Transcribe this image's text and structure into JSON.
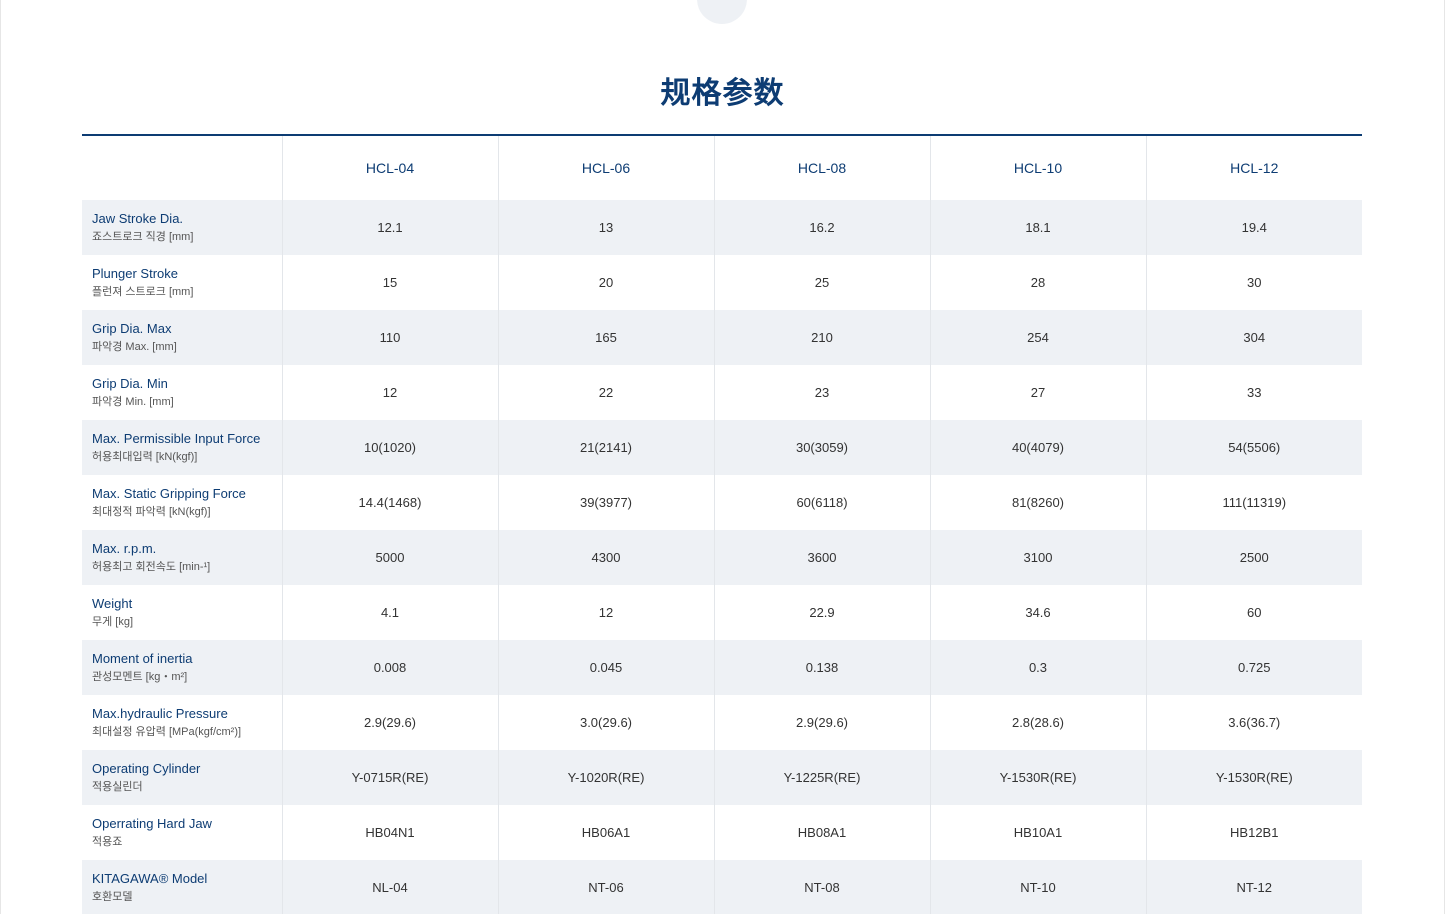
{
  "title": "规格参数",
  "columns": [
    "HCL-04",
    "HCL-06",
    "HCL-08",
    "HCL-10",
    "HCL-12"
  ],
  "rows": [
    {
      "label_en": "Jaw Stroke Dia.",
      "label_ko": "죠스트로크 직경 [mm]",
      "values": [
        "12.1",
        "13",
        "16.2",
        "18.1",
        "19.4"
      ]
    },
    {
      "label_en": "Plunger Stroke",
      "label_ko": "플런져 스트로크 [mm]",
      "values": [
        "15",
        "20",
        "25",
        "28",
        "30"
      ]
    },
    {
      "label_en": "Grip Dia. Max",
      "label_ko": "파악경 Max. [mm]",
      "values": [
        "110",
        "165",
        "210",
        "254",
        "304"
      ]
    },
    {
      "label_en": "Grip Dia. Min",
      "label_ko": "파악경 Min. [mm]",
      "values": [
        "12",
        "22",
        "23",
        "27",
        "33"
      ]
    },
    {
      "label_en": "Max. Permissible Input Force",
      "label_ko": "허용최대입력 [kN(kgf)]",
      "values": [
        "10(1020)",
        "21(2141)",
        "30(3059)",
        "40(4079)",
        "54(5506)"
      ]
    },
    {
      "label_en": "Max. Static Gripping Force",
      "label_ko": "최대정적 파악력 [kN(kgf)]",
      "values": [
        "14.4(1468)",
        "39(3977)",
        "60(6118)",
        "81(8260)",
        "111(11319)"
      ]
    },
    {
      "label_en": "Max. r.p.m.",
      "label_ko": "허용최고 회전속도 [min-¹]",
      "values": [
        "5000",
        "4300",
        "3600",
        "3100",
        "2500"
      ]
    },
    {
      "label_en": "Weight",
      "label_ko": "무게 [kg]",
      "values": [
        "4.1",
        "12",
        "22.9",
        "34.6",
        "60"
      ]
    },
    {
      "label_en": "Moment of inertia",
      "label_ko": "관성모멘트 [kg・m²]",
      "values": [
        "0.008",
        "0.045",
        "0.138",
        "0.3",
        "0.725"
      ]
    },
    {
      "label_en": "Max.hydraulic Pressure",
      "label_ko": "최대설정 유압력 [MPa(kgf/cm²)]",
      "values": [
        "2.9(29.6)",
        "3.0(29.6)",
        "2.9(29.6)",
        "2.8(28.6)",
        "3.6(36.7)"
      ]
    },
    {
      "label_en": "Operating Cylinder",
      "label_ko": "적용실린더",
      "values": [
        "Y-0715R(RE)",
        "Y-1020R(RE)",
        "Y-1225R(RE)",
        "Y-1530R(RE)",
        "Y-1530R(RE)"
      ]
    },
    {
      "label_en": "Operrating Hard Jaw",
      "label_ko": "적용죠",
      "values": [
        "HB04N1",
        "HB06A1",
        "HB08A1",
        "HB10A1",
        "HB12B1"
      ]
    },
    {
      "label_en": "KITAGAWA® Model",
      "label_ko": "호환모델",
      "values": [
        "NL-04",
        "NT-06",
        "NT-08",
        "NT-10",
        "NT-12"
      ]
    }
  ]
}
